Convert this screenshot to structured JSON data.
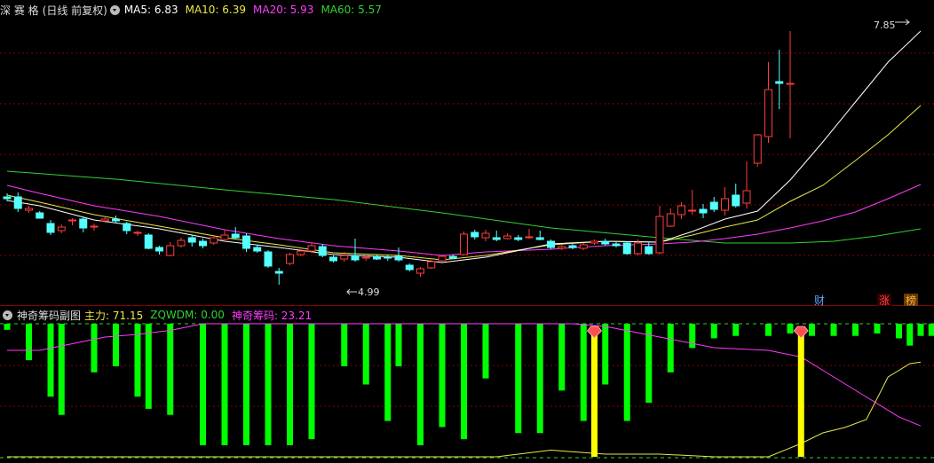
{
  "main_header": {
    "stock_name": "深 赛 格",
    "period": "(日线 前复权)",
    "indicators": [
      {
        "label": "MA5: 6.83",
        "color": "#ffffff"
      },
      {
        "label": "MA10: 6.39",
        "color": "#e8e84a"
      },
      {
        "label": "MA20: 5.93",
        "color": "#ff3cff"
      },
      {
        "label": "MA60: 5.57",
        "color": "#32d232"
      }
    ]
  },
  "sub_header": {
    "panel_name": "神奇筹码副图",
    "indicators": [
      {
        "label": "主力: 71.15",
        "color": "#e8e84a"
      },
      {
        "label": "ZQWDM: 0.00",
        "color": "#32d232"
      },
      {
        "label": "神奇筹码: 23.21",
        "color": "#ff3cff"
      }
    ]
  },
  "annotations": {
    "high": "7.85",
    "low": "4.99"
  },
  "event_markers": [
    "财",
    "涨",
    "榜"
  ],
  "colors": {
    "up": "#ff3c3c",
    "down": "#54ffff",
    "ma5": "#ffffff",
    "ma10": "#e8e84a",
    "ma20": "#ff3cff",
    "ma60": "#32d232",
    "grid": "#8a0000",
    "hist": "#00ff00",
    "signal": "#ffff00",
    "marker": "#ff5050"
  },
  "chart_data": {
    "type": "candlestick",
    "ylim": [
      4.9,
      8.0
    ],
    "candles": [
      [
        5.98,
        5.96,
        6.02,
        5.93
      ],
      [
        5.98,
        5.85,
        6.03,
        5.81
      ],
      [
        5.83,
        5.85,
        5.88,
        5.8
      ],
      [
        5.8,
        5.74,
        5.82,
        5.74
      ],
      [
        5.68,
        5.58,
        5.72,
        5.55
      ],
      [
        5.6,
        5.64,
        5.67,
        5.57
      ],
      [
        5.72,
        5.72,
        5.74,
        5.66
      ],
      [
        5.73,
        5.63,
        5.76,
        5.58
      ],
      [
        5.65,
        5.65,
        5.68,
        5.6
      ],
      [
        5.71,
        5.73,
        5.75,
        5.69
      ],
      [
        5.73,
        5.71,
        5.77,
        5.68
      ],
      [
        5.68,
        5.6,
        5.7,
        5.56
      ],
      [
        5.58,
        5.58,
        5.6,
        5.54
      ],
      [
        5.55,
        5.4,
        5.57,
        5.39
      ],
      [
        5.41,
        5.37,
        5.43,
        5.33
      ],
      [
        5.32,
        5.43,
        5.47,
        5.31
      ],
      [
        5.43,
        5.49,
        5.52,
        5.41
      ],
      [
        5.52,
        5.47,
        5.55,
        5.42
      ],
      [
        5.48,
        5.43,
        5.51,
        5.4
      ],
      [
        5.46,
        5.52,
        5.54,
        5.44
      ],
      [
        5.5,
        5.55,
        5.61,
        5.48
      ],
      [
        5.56,
        5.52,
        5.64,
        5.5
      ],
      [
        5.54,
        5.4,
        5.57,
        5.36
      ],
      [
        5.41,
        5.37,
        5.44,
        5.35
      ],
      [
        5.36,
        5.2,
        5.38,
        5.18
      ],
      [
        5.14,
        5.12,
        5.18,
        4.99
      ],
      [
        5.23,
        5.33,
        5.35,
        5.21
      ],
      [
        5.33,
        5.37,
        5.39,
        5.31
      ],
      [
        5.37,
        5.43,
        5.46,
        5.35
      ],
      [
        5.42,
        5.32,
        5.45,
        5.3
      ],
      [
        5.3,
        5.26,
        5.32,
        5.24
      ],
      [
        5.28,
        5.32,
        5.36,
        5.25
      ],
      [
        5.32,
        5.27,
        5.51,
        5.25
      ],
      [
        5.29,
        5.3,
        5.32,
        5.26
      ],
      [
        5.31,
        5.28,
        5.33,
        5.27
      ],
      [
        5.3,
        5.29,
        5.33,
        5.26
      ],
      [
        5.31,
        5.27,
        5.41,
        5.25
      ],
      [
        5.21,
        5.16,
        5.23,
        5.14
      ],
      [
        5.12,
        5.17,
        5.19,
        5.08
      ],
      [
        5.18,
        5.25,
        5.27,
        5.17
      ],
      [
        5.26,
        5.31,
        5.33,
        5.25
      ],
      [
        5.31,
        5.29,
        5.33,
        5.28
      ],
      [
        5.33,
        5.56,
        5.59,
        5.32
      ],
      [
        5.58,
        5.53,
        5.61,
        5.5
      ],
      [
        5.52,
        5.57,
        5.61,
        5.48
      ],
      [
        5.52,
        5.5,
        5.6,
        5.48
      ],
      [
        5.51,
        5.54,
        5.57,
        5.5
      ],
      [
        5.52,
        5.5,
        5.55,
        5.48
      ],
      [
        5.53,
        5.53,
        5.62,
        5.51
      ],
      [
        5.52,
        5.5,
        5.6,
        5.49
      ],
      [
        5.48,
        5.41,
        5.5,
        5.39
      ],
      [
        5.4,
        5.42,
        5.44,
        5.38
      ],
      [
        5.43,
        5.41,
        5.45,
        5.39
      ],
      [
        5.4,
        5.44,
        5.46,
        5.38
      ],
      [
        5.46,
        5.48,
        5.5,
        5.44
      ],
      [
        5.48,
        5.45,
        5.51,
        5.43
      ],
      [
        5.45,
        5.43,
        5.47,
        5.41
      ],
      [
        5.46,
        5.34,
        5.48,
        5.33
      ],
      [
        5.34,
        5.46,
        5.5,
        5.32
      ],
      [
        5.42,
        5.34,
        5.48,
        5.33
      ],
      [
        5.35,
        5.76,
        5.88,
        5.33
      ],
      [
        5.65,
        5.79,
        5.85,
        5.64
      ],
      [
        5.78,
        5.88,
        5.92,
        5.73
      ],
      [
        5.83,
        5.83,
        6.06,
        5.78
      ],
      [
        5.84,
        5.8,
        5.9,
        5.74
      ],
      [
        5.92,
        5.84,
        5.98,
        5.81
      ],
      [
        5.83,
        5.96,
        6.09,
        5.77
      ],
      [
        6.0,
        5.88,
        6.13,
        5.86
      ],
      [
        5.91,
        6.05,
        6.38,
        5.85
      ],
      [
        6.36,
        6.68,
        6.69,
        6.32
      ],
      [
        6.66,
        7.19,
        7.5,
        6.59
      ],
      [
        7.28,
        7.26,
        7.64,
        6.97
      ],
      [
        7.26,
        7.26,
        7.85,
        6.64
      ]
    ],
    "ma5": [
      [
        0,
        5.94
      ],
      [
        3,
        5.88
      ],
      [
        8,
        5.72
      ],
      [
        14,
        5.62
      ],
      [
        20,
        5.48
      ],
      [
        25,
        5.41
      ],
      [
        30,
        5.33
      ],
      [
        36,
        5.3
      ],
      [
        40,
        5.24
      ],
      [
        44,
        5.3
      ],
      [
        50,
        5.45
      ],
      [
        55,
        5.48
      ],
      [
        60,
        5.47
      ],
      [
        63,
        5.59
      ],
      [
        66,
        5.73
      ],
      [
        69,
        5.82
      ],
      [
        72,
        6.17
      ],
      [
        75,
        6.6
      ],
      [
        78,
        7.05
      ],
      [
        81,
        7.5
      ],
      [
        84,
        7.85
      ]
    ],
    "ma10": [
      [
        0,
        6.0
      ],
      [
        3,
        5.92
      ],
      [
        8,
        5.78
      ],
      [
        14,
        5.65
      ],
      [
        20,
        5.52
      ],
      [
        25,
        5.44
      ],
      [
        30,
        5.35
      ],
      [
        36,
        5.32
      ],
      [
        40,
        5.27
      ],
      [
        44,
        5.32
      ],
      [
        50,
        5.44
      ],
      [
        55,
        5.48
      ],
      [
        60,
        5.47
      ],
      [
        63,
        5.55
      ],
      [
        66,
        5.64
      ],
      [
        69,
        5.72
      ],
      [
        72,
        5.93
      ],
      [
        75,
        6.11
      ],
      [
        78,
        6.39
      ],
      [
        81,
        6.68
      ],
      [
        84,
        7.01
      ]
    ],
    "ma20": [
      [
        0,
        6.11
      ],
      [
        3,
        6.02
      ],
      [
        8,
        5.88
      ],
      [
        14,
        5.76
      ],
      [
        20,
        5.61
      ],
      [
        25,
        5.51
      ],
      [
        30,
        5.43
      ],
      [
        36,
        5.37
      ],
      [
        40,
        5.32
      ],
      [
        44,
        5.36
      ],
      [
        50,
        5.39
      ],
      [
        55,
        5.43
      ],
      [
        60,
        5.45
      ],
      [
        63,
        5.47
      ],
      [
        66,
        5.51
      ],
      [
        69,
        5.56
      ],
      [
        72,
        5.63
      ],
      [
        75,
        5.71
      ],
      [
        78,
        5.81
      ],
      [
        81,
        5.96
      ],
      [
        84,
        6.12
      ]
    ],
    "ma60": [
      [
        0,
        6.27
      ],
      [
        10,
        6.18
      ],
      [
        20,
        6.06
      ],
      [
        30,
        5.95
      ],
      [
        40,
        5.8
      ],
      [
        50,
        5.63
      ],
      [
        60,
        5.52
      ],
      [
        66,
        5.46
      ],
      [
        72,
        5.46
      ],
      [
        76,
        5.48
      ],
      [
        80,
        5.54
      ],
      [
        84,
        5.62
      ]
    ],
    "sub_ylim": [
      0,
      100
    ],
    "zqwdm_hist": [
      96,
      81,
      65,
      63,
      59,
      52,
      0,
      0,
      0,
      0,
      0,
      0,
      0,
      0,
      57,
      55,
      54,
      53,
      54,
      66,
      71,
      63,
      50,
      45,
      0,
      0,
      0,
      0,
      0,
      86,
      83,
      72,
      62,
      59,
      0,
      0,
      0,
      0,
      0,
      0,
      0,
      95,
      90,
      86,
      82,
      82,
      75,
      72,
      83,
      79,
      75,
      74,
      71,
      86,
      87,
      89,
      84,
      85,
      86
    ],
    "hist_bars": [
      [
        0,
        5
      ],
      [
        2,
        30
      ],
      [
        4,
        60
      ],
      [
        5,
        75
      ],
      [
        8,
        40
      ],
      [
        10,
        35
      ],
      [
        12,
        60
      ],
      [
        13,
        70
      ],
      [
        15,
        75
      ],
      [
        18,
        100
      ],
      [
        20,
        100
      ],
      [
        22,
        100
      ],
      [
        24,
        100
      ],
      [
        26,
        100
      ],
      [
        28,
        95
      ],
      [
        31,
        35
      ],
      [
        33,
        50
      ],
      [
        35,
        80
      ],
      [
        36,
        35
      ],
      [
        38,
        100
      ],
      [
        40,
        85
      ],
      [
        42,
        95
      ],
      [
        44,
        45
      ],
      [
        47,
        90
      ],
      [
        49,
        90
      ],
      [
        51,
        55
      ],
      [
        53,
        80
      ],
      [
        55,
        50
      ],
      [
        57,
        80
      ],
      [
        59,
        65
      ],
      [
        61,
        40
      ],
      [
        63,
        20
      ],
      [
        65,
        12
      ],
      [
        67,
        10
      ],
      [
        70,
        10
      ],
      [
        72,
        8
      ],
      [
        74,
        10
      ],
      [
        76,
        10
      ],
      [
        78,
        10
      ],
      [
        80,
        8
      ],
      [
        82,
        12
      ],
      [
        83,
        18
      ],
      [
        84,
        10
      ],
      [
        85,
        10
      ]
    ],
    "zhuli": [
      [
        0,
        0
      ],
      [
        45,
        0
      ],
      [
        50,
        5
      ],
      [
        55,
        2
      ],
      [
        60,
        2
      ],
      [
        65,
        0
      ],
      [
        70,
        0
      ],
      [
        73,
        10
      ],
      [
        75,
        18
      ],
      [
        77,
        22
      ],
      [
        79,
        28
      ],
      [
        81,
        60
      ],
      [
        83,
        70
      ],
      [
        84,
        71.15
      ]
    ],
    "shenqi": [
      [
        0,
        80
      ],
      [
        3,
        80
      ],
      [
        6,
        85
      ],
      [
        9,
        90
      ],
      [
        12,
        92
      ],
      [
        15,
        95
      ],
      [
        18,
        100
      ],
      [
        21,
        100
      ],
      [
        24,
        100
      ],
      [
        28,
        100
      ],
      [
        32,
        100
      ],
      [
        36,
        100
      ],
      [
        40,
        100
      ],
      [
        44,
        100
      ],
      [
        48,
        100
      ],
      [
        52,
        100
      ],
      [
        55,
        98
      ],
      [
        60,
        90
      ],
      [
        65,
        82
      ],
      [
        70,
        80
      ],
      [
        73,
        75
      ],
      [
        76,
        60
      ],
      [
        79,
        45
      ],
      [
        82,
        30
      ],
      [
        84,
        23.21
      ]
    ],
    "signals": [
      54,
      73
    ]
  }
}
